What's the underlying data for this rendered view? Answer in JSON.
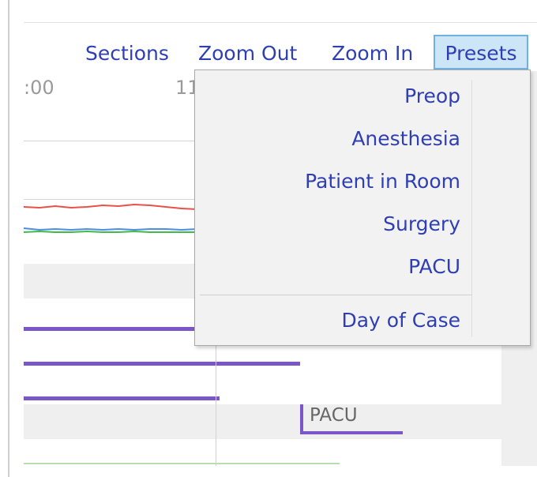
{
  "toolbar": {
    "sections_label": "Sections",
    "zoom_out_label": "Zoom Out",
    "zoom_in_label": "Zoom In",
    "presets_label": "Presets"
  },
  "timeline": {
    "tick_labels": [
      ":00",
      "11"
    ],
    "pacu_label": "PACU",
    "vital_colors": {
      "red": "#e8504a",
      "blue": "#4a8fe0",
      "green": "#45b84a",
      "bar_purple": "#7b56c9"
    }
  },
  "presets_menu": {
    "items": [
      "Preop",
      "Anesthesia",
      "Patient in Room",
      "Surgery",
      "PACU",
      "Day of Case"
    ]
  },
  "colors": {
    "link_blue": "#2f3fb3",
    "presets_highlight": "#cde6f7",
    "presets_border": "#6fb1e2"
  }
}
